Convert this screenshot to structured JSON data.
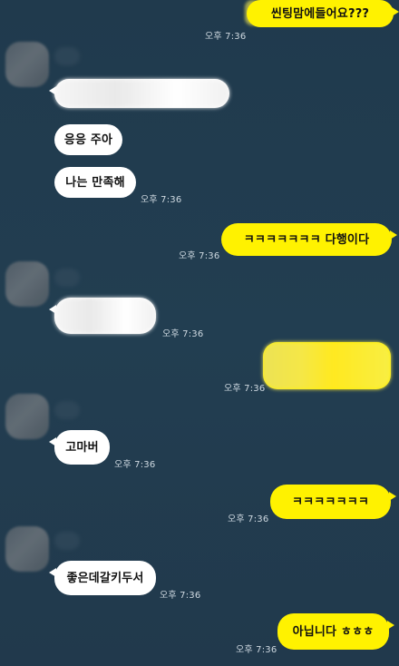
{
  "conversation": {
    "messages": [
      {
        "text": "씬팅맘에들어요???"
      },
      {
        "text": ""
      },
      {
        "text": "응응 주아"
      },
      {
        "text": "나는 만족해"
      },
      {
        "text": "ㅋㅋㅋㅋㅋㅋㅋ 다행이다"
      },
      {
        "text": ""
      },
      {
        "text": ""
      },
      {
        "text": "고마버"
      },
      {
        "text": "ㅋㅋㅋㅋㅋㅋㅋ"
      },
      {
        "text": "좋은데갈키두서"
      },
      {
        "text": "아닙니다 ㅎㅎㅎ"
      }
    ],
    "timestamps": [
      "오후 7:36",
      "오후 7:36",
      "오후 7:36",
      "오후 7:36",
      "오후 7:36",
      "오후 7:36",
      "오후 7:36",
      "오후 7:36",
      "오후 7:36",
      "오후 7:36"
    ]
  },
  "colors": {
    "background": "#223e51",
    "incoming_bubble": "#ffffff",
    "outgoing_bubble": "#fff200",
    "text": "#111111",
    "timestamp": "#cfd9e1"
  }
}
